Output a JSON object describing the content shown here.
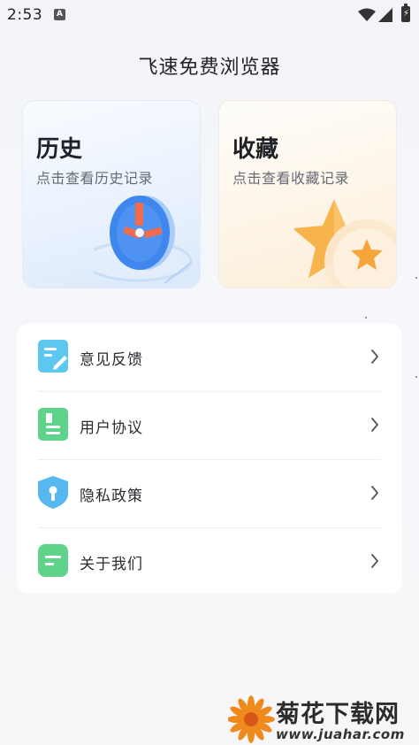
{
  "status_bar": {
    "time": "2:53",
    "indicator": "A",
    "battery_icon": "battery-charging-icon"
  },
  "app": {
    "title": "飞速免费浏览器"
  },
  "cards": [
    {
      "id": "history",
      "title": "历史",
      "subtitle": "点击查看历史记录",
      "icon": "clock-icon"
    },
    {
      "id": "favorites",
      "title": "收藏",
      "subtitle": "点击查看收藏记录",
      "icon": "star-icon"
    }
  ],
  "menu": {
    "items": [
      {
        "label": "意见反馈",
        "icon": "feedback-icon",
        "color": "#5cc8f0"
      },
      {
        "label": "用户协议",
        "icon": "document-icon",
        "color": "#5fd38a"
      },
      {
        "label": "隐私政策",
        "icon": "shield-icon",
        "color": "#56b8ee"
      },
      {
        "label": "关于我们",
        "icon": "message-icon",
        "color": "#5fd38a"
      }
    ]
  },
  "watermark": {
    "text": "菊花下载网",
    "url": "www.juahar.com"
  }
}
